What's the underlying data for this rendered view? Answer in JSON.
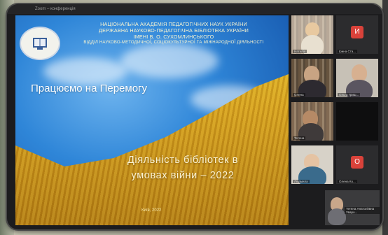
{
  "window": {
    "title": "Zoom – конференція"
  },
  "slide": {
    "header_lines": [
      "Національна академія педагогічних наук України",
      "Державна науково-педагогічна бібліотека України",
      "імені В. О. Сухомлинського",
      "Відділ науково-методичної, соціокультурної та міжнародної діяльності"
    ],
    "motto": "Працюємо на Перемогу",
    "subtitle_line1": "Діяльність бібліотек в",
    "subtitle_line2": "умовах війни – 2022",
    "city_year": "Київ, 2022"
  },
  "participants": [
    {
      "name": "Наталія",
      "type": "video"
    },
    {
      "name": "Ірина Ста...",
      "type": "avatar",
      "initial": "И",
      "color": "#d9423a"
    },
    {
      "name": "Олена",
      "type": "video"
    },
    {
      "name": "Ольга Гриш...",
      "type": "video"
    },
    {
      "name": "Тетяна",
      "type": "video"
    },
    {
      "name": "",
      "type": "blank"
    },
    {
      "name": "Людмила",
      "type": "video"
    },
    {
      "name": "Олена Ко...",
      "type": "avatar",
      "initial": "О",
      "color": "#d9423a"
    },
    {
      "name": "Тетяна Анатоліївна Уваро...",
      "type": "video"
    }
  ]
}
